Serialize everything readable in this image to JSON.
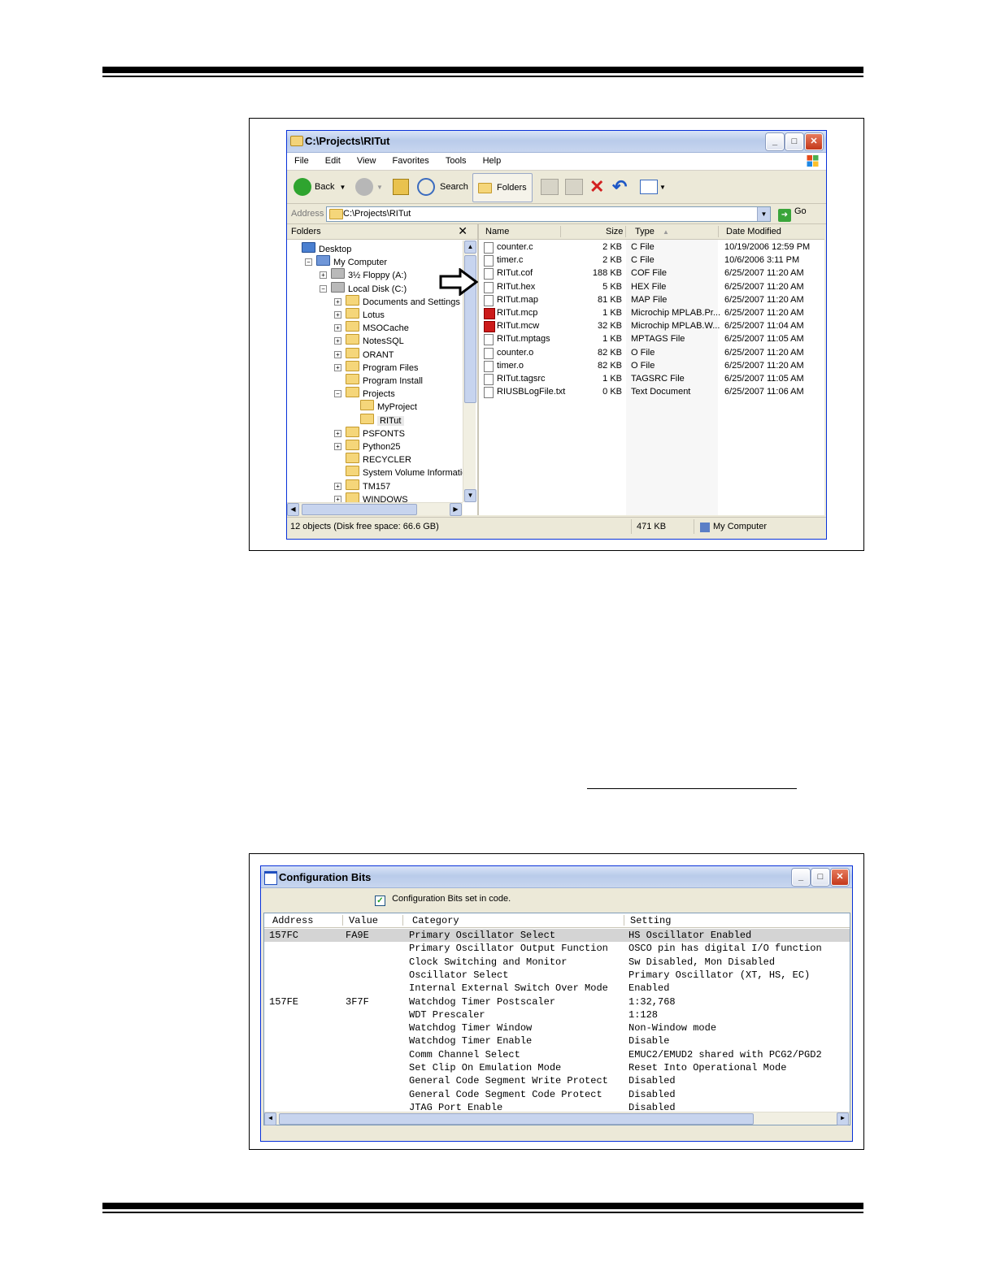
{
  "explorer": {
    "title": "C:\\Projects\\RITut",
    "menu": [
      "File",
      "Edit",
      "View",
      "Favorites",
      "Tools",
      "Help"
    ],
    "toolbar": {
      "back": "Back",
      "search": "Search",
      "folders": "Folders"
    },
    "address_label": "Address",
    "address_value": "C:\\Projects\\RITut",
    "go": "Go",
    "folders_header": "Folders",
    "close_glyph": "✕",
    "tree": [
      {
        "label": "Desktop",
        "indent": 0,
        "pm": ""
      },
      {
        "label": "My Computer",
        "indent": 1,
        "pm": "−"
      },
      {
        "label": "3½ Floppy (A:)",
        "indent": 2,
        "pm": "+"
      },
      {
        "label": "Local Disk (C:)",
        "indent": 2,
        "pm": "−"
      },
      {
        "label": "Documents and Settings",
        "indent": 3,
        "pm": "+"
      },
      {
        "label": "Lotus",
        "indent": 3,
        "pm": "+"
      },
      {
        "label": "MSOCache",
        "indent": 3,
        "pm": "+"
      },
      {
        "label": "NotesSQL",
        "indent": 3,
        "pm": "+"
      },
      {
        "label": "ORANT",
        "indent": 3,
        "pm": "+"
      },
      {
        "label": "Program Files",
        "indent": 3,
        "pm": "+"
      },
      {
        "label": "Program Install",
        "indent": 3,
        "pm": ""
      },
      {
        "label": "Projects",
        "indent": 3,
        "pm": "−"
      },
      {
        "label": "MyProject",
        "indent": 4,
        "pm": ""
      },
      {
        "label": "RITut",
        "indent": 4,
        "pm": "",
        "selected": true
      },
      {
        "label": "PSFONTS",
        "indent": 3,
        "pm": "+"
      },
      {
        "label": "Python25",
        "indent": 3,
        "pm": "+"
      },
      {
        "label": "RECYCLER",
        "indent": 3,
        "pm": ""
      },
      {
        "label": "System Volume Information",
        "indent": 3,
        "pm": ""
      },
      {
        "label": "TM157",
        "indent": 3,
        "pm": "+"
      },
      {
        "label": "WINDOWS",
        "indent": 3,
        "pm": "+"
      }
    ],
    "columns": {
      "name": "Name",
      "size": "Size",
      "type": "Type",
      "date": "Date Modified"
    },
    "files": [
      {
        "name": "counter.c",
        "size": "2 KB",
        "type": "C File",
        "date": "10/19/2006 12:59 PM",
        "icon": "text-file-icon"
      },
      {
        "name": "timer.c",
        "size": "2 KB",
        "type": "C File",
        "date": "10/6/2006 3:11 PM",
        "icon": "text-file-icon"
      },
      {
        "name": "RITut.cof",
        "size": "188 KB",
        "type": "COF File",
        "date": "6/25/2007 11:20 AM",
        "icon": "binary-file-icon"
      },
      {
        "name": "RITut.hex",
        "size": "5 KB",
        "type": "HEX File",
        "date": "6/25/2007 11:20 AM",
        "icon": "binary-file-icon"
      },
      {
        "name": "RITut.map",
        "size": "81 KB",
        "type": "MAP File",
        "date": "6/25/2007 11:20 AM",
        "icon": "binary-file-icon"
      },
      {
        "name": "RITut.mcp",
        "size": "1 KB",
        "type": "Microchip MPLAB.Pr...",
        "date": "6/25/2007 11:20 AM",
        "icon": "mplab-icon"
      },
      {
        "name": "RITut.mcw",
        "size": "32 KB",
        "type": "Microchip MPLAB.W...",
        "date": "6/25/2007 11:04 AM",
        "icon": "mplab-icon"
      },
      {
        "name": "RITut.mptags",
        "size": "1 KB",
        "type": "MPTAGS File",
        "date": "6/25/2007 11:05 AM",
        "icon": "binary-file-icon"
      },
      {
        "name": "counter.o",
        "size": "82 KB",
        "type": "O File",
        "date": "6/25/2007 11:20 AM",
        "icon": "binary-file-icon"
      },
      {
        "name": "timer.o",
        "size": "82 KB",
        "type": "O File",
        "date": "6/25/2007 11:20 AM",
        "icon": "binary-file-icon"
      },
      {
        "name": "RITut.tagsrc",
        "size": "1 KB",
        "type": "TAGSRC File",
        "date": "6/25/2007 11:05 AM",
        "icon": "binary-file-icon"
      },
      {
        "name": "RIUSBLogFile.txt",
        "size": "0 KB",
        "type": "Text Document",
        "date": "6/25/2007 11:06 AM",
        "icon": "text-file-icon"
      }
    ],
    "status": {
      "objects": "12 objects (Disk free space: 66.6 GB)",
      "size": "471 KB",
      "location": "My Computer"
    }
  },
  "config": {
    "title": "Configuration Bits",
    "checkbox_label": "Configuration Bits set in code.",
    "columns": {
      "address": "Address",
      "value": "Value",
      "category": "Category",
      "setting": "Setting"
    },
    "rows": [
      {
        "address": "157FC",
        "value": "FA9E",
        "category": "Primary Oscillator Select",
        "setting": "HS Oscillator Enabled",
        "highlight": true
      },
      {
        "address": "",
        "value": "",
        "category": "Primary Oscillator Output Function",
        "setting": "OSCO pin has digital I/O function"
      },
      {
        "address": "",
        "value": "",
        "category": "Clock Switching and Monitor",
        "setting": "Sw Disabled, Mon Disabled"
      },
      {
        "address": "",
        "value": "",
        "category": "Oscillator Select",
        "setting": "Primary Oscillator (XT, HS, EC)"
      },
      {
        "address": "",
        "value": "",
        "category": "Internal External Switch Over Mode",
        "setting": "Enabled"
      },
      {
        "address": "157FE",
        "value": "3F7F",
        "category": "Watchdog Timer Postscaler",
        "setting": "1:32,768"
      },
      {
        "address": "",
        "value": "",
        "category": "WDT Prescaler",
        "setting": "1:128"
      },
      {
        "address": "",
        "value": "",
        "category": "Watchdog Timer Window",
        "setting": "Non-Window mode"
      },
      {
        "address": "",
        "value": "",
        "category": "Watchdog Timer Enable",
        "setting": "Disable"
      },
      {
        "address": "",
        "value": "",
        "category": "Comm Channel Select",
        "setting": "EMUC2/EMUD2 shared with PCG2/PGD2"
      },
      {
        "address": "",
        "value": "",
        "category": "Set Clip On Emulation Mode",
        "setting": "Reset Into Operational Mode"
      },
      {
        "address": "",
        "value": "",
        "category": "General Code Segment Write Protect",
        "setting": "Disabled"
      },
      {
        "address": "",
        "value": "",
        "category": "General Code Segment Code Protect",
        "setting": "Disabled"
      },
      {
        "address": "",
        "value": "",
        "category": "JTAG Port Enable",
        "setting": "Disabled"
      }
    ]
  },
  "window_buttons": {
    "minimize": "_",
    "maximize": "□",
    "close": "✕"
  }
}
